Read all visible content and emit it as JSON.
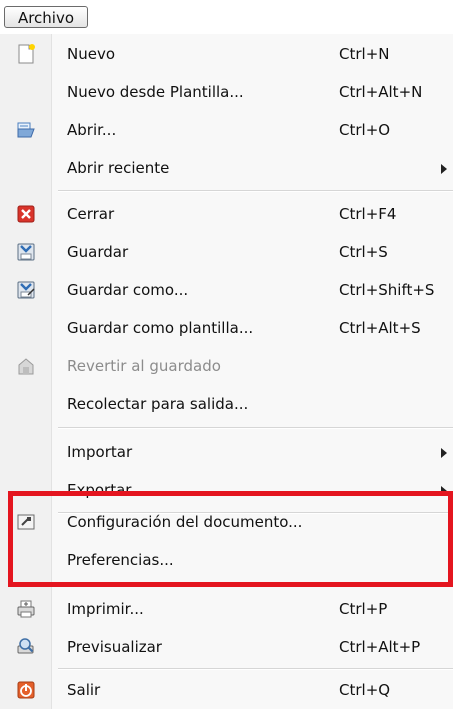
{
  "menubar": {
    "title": "Archivo"
  },
  "menu": {
    "items": [
      {
        "label": "Nuevo",
        "shortcut": "Ctrl+N",
        "icon": "new-document-icon"
      },
      {
        "label": "Nuevo desde Plantilla...",
        "shortcut": "Ctrl+Alt+N"
      },
      {
        "label": "Abrir...",
        "shortcut": "Ctrl+O",
        "icon": "open-folder-icon"
      },
      {
        "label": "Abrir reciente",
        "submenu": true
      },
      {
        "label": "Cerrar",
        "shortcut": "Ctrl+F4",
        "icon": "close-icon"
      },
      {
        "label": "Guardar",
        "shortcut": "Ctrl+S",
        "icon": "save-icon"
      },
      {
        "label": "Guardar como...",
        "shortcut": "Ctrl+Shift+S",
        "icon": "save-as-icon"
      },
      {
        "label": "Guardar como plantilla...",
        "shortcut": "Ctrl+Alt+S"
      },
      {
        "label": "Revertir al guardado",
        "disabled": true,
        "icon": "revert-icon"
      },
      {
        "label": "Recolectar para salida..."
      },
      {
        "label": "Importar",
        "submenu": true
      },
      {
        "label": "Exportar",
        "submenu": true
      },
      {
        "label": "Configuración del documento...",
        "icon": "document-settings-icon"
      },
      {
        "label": "Preferencias..."
      },
      {
        "label": "Imprimir...",
        "shortcut": "Ctrl+P",
        "icon": "print-icon"
      },
      {
        "label": "Previsualizar",
        "shortcut": "Ctrl+Alt+P",
        "icon": "print-preview-icon"
      },
      {
        "label": "Salir",
        "shortcut": "Ctrl+Q",
        "icon": "quit-icon"
      }
    ]
  },
  "colors": {
    "highlight": "#e4151f",
    "disabled_text": "#8c8c8c",
    "close_red": "#d9342b",
    "quit_orange": "#e4602b"
  }
}
